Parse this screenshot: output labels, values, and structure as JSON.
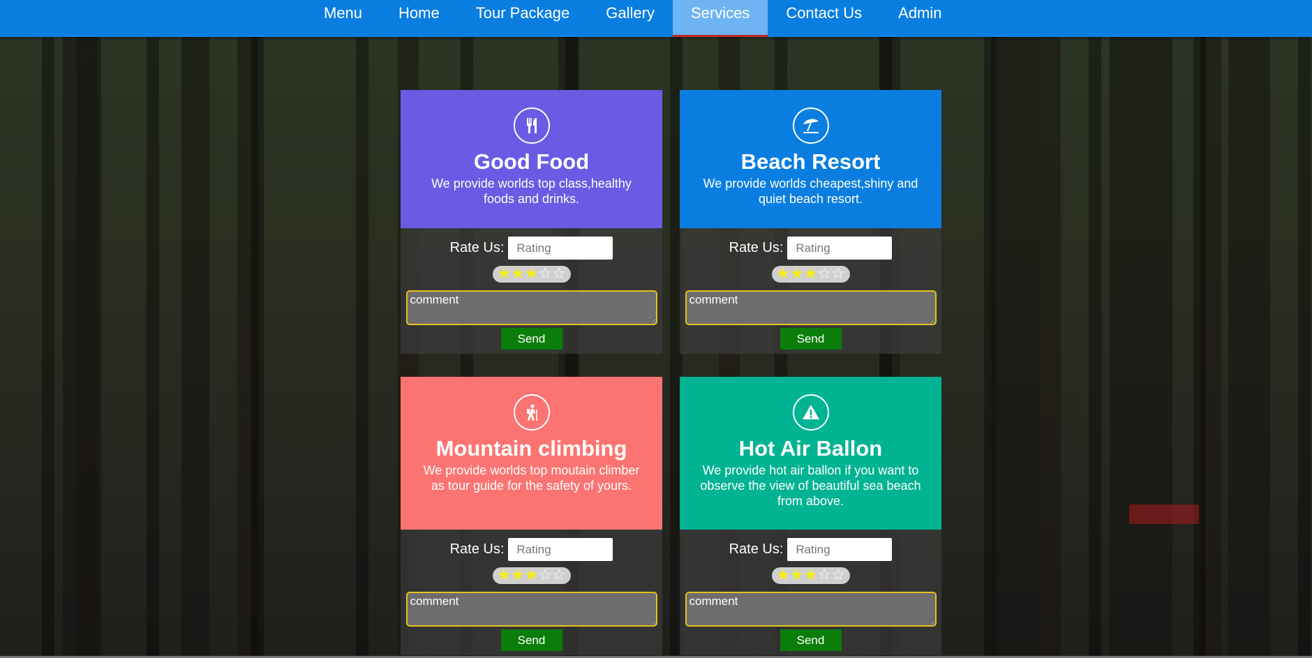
{
  "nav": {
    "items": [
      "Menu",
      "Home",
      "Tour Package",
      "Gallery",
      "Services",
      "Contact Us",
      "Admin"
    ],
    "active": "Services",
    "color": "#0a7ee0",
    "active_color": "#6fb4f2"
  },
  "cards": [
    {
      "title": "Good Food",
      "description": "We provide worlds top class,healthy foods and drinks.",
      "icon": "fork-knife-icon",
      "color": "#6b5ae3",
      "rate_label": "Rate Us:",
      "rating_placeholder": "Rating",
      "rating_stars": 3,
      "comment_placeholder": "comment",
      "send_label": "Send"
    },
    {
      "title": "Beach Resort",
      "description": "We provide worlds cheapest,shiny and quiet beach resort.",
      "icon": "beach-umbrella-icon",
      "color": "#0a7ee0",
      "rate_label": "Rate Us:",
      "rating_placeholder": "Rating",
      "rating_stars": 3,
      "comment_placeholder": "comment",
      "send_label": "Send"
    },
    {
      "title": "Mountain climbing",
      "description": "We provide worlds top moutain climber as tour guide for the safety of yours.",
      "icon": "hiker-icon",
      "color": "#fb7471",
      "rate_label": "Rate Us:",
      "rating_placeholder": "Rating",
      "rating_stars": 3,
      "comment_placeholder": "comment",
      "send_label": "Send"
    },
    {
      "title": "Hot Air Ballon",
      "description": "We provide hot air ballon if you want to observe the view of beautiful sea beach from above.",
      "icon": "warning-icon",
      "color": "#00b392",
      "rate_label": "Rate Us:",
      "rating_placeholder": "Rating",
      "rating_stars": 3,
      "comment_placeholder": "comment",
      "send_label": "Send"
    }
  ]
}
